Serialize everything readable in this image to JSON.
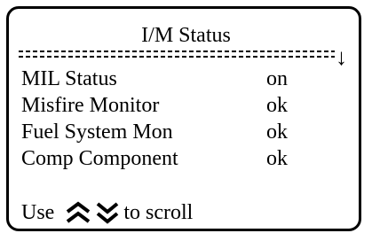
{
  "screen": {
    "title": "I/M Status",
    "scroll_indicator": "↓",
    "rows": [
      {
        "label": "MIL Status",
        "value": "on"
      },
      {
        "label": "Misfire Monitor",
        "value": "ok"
      },
      {
        "label": "Fuel System Mon",
        "value": "ok"
      },
      {
        "label": "Comp Component",
        "value": "ok"
      }
    ],
    "footer": {
      "prefix": "Use",
      "suffix": "to scroll",
      "up_icon": "double-chevron-up-icon",
      "down_icon": "double-chevron-down-icon"
    }
  }
}
